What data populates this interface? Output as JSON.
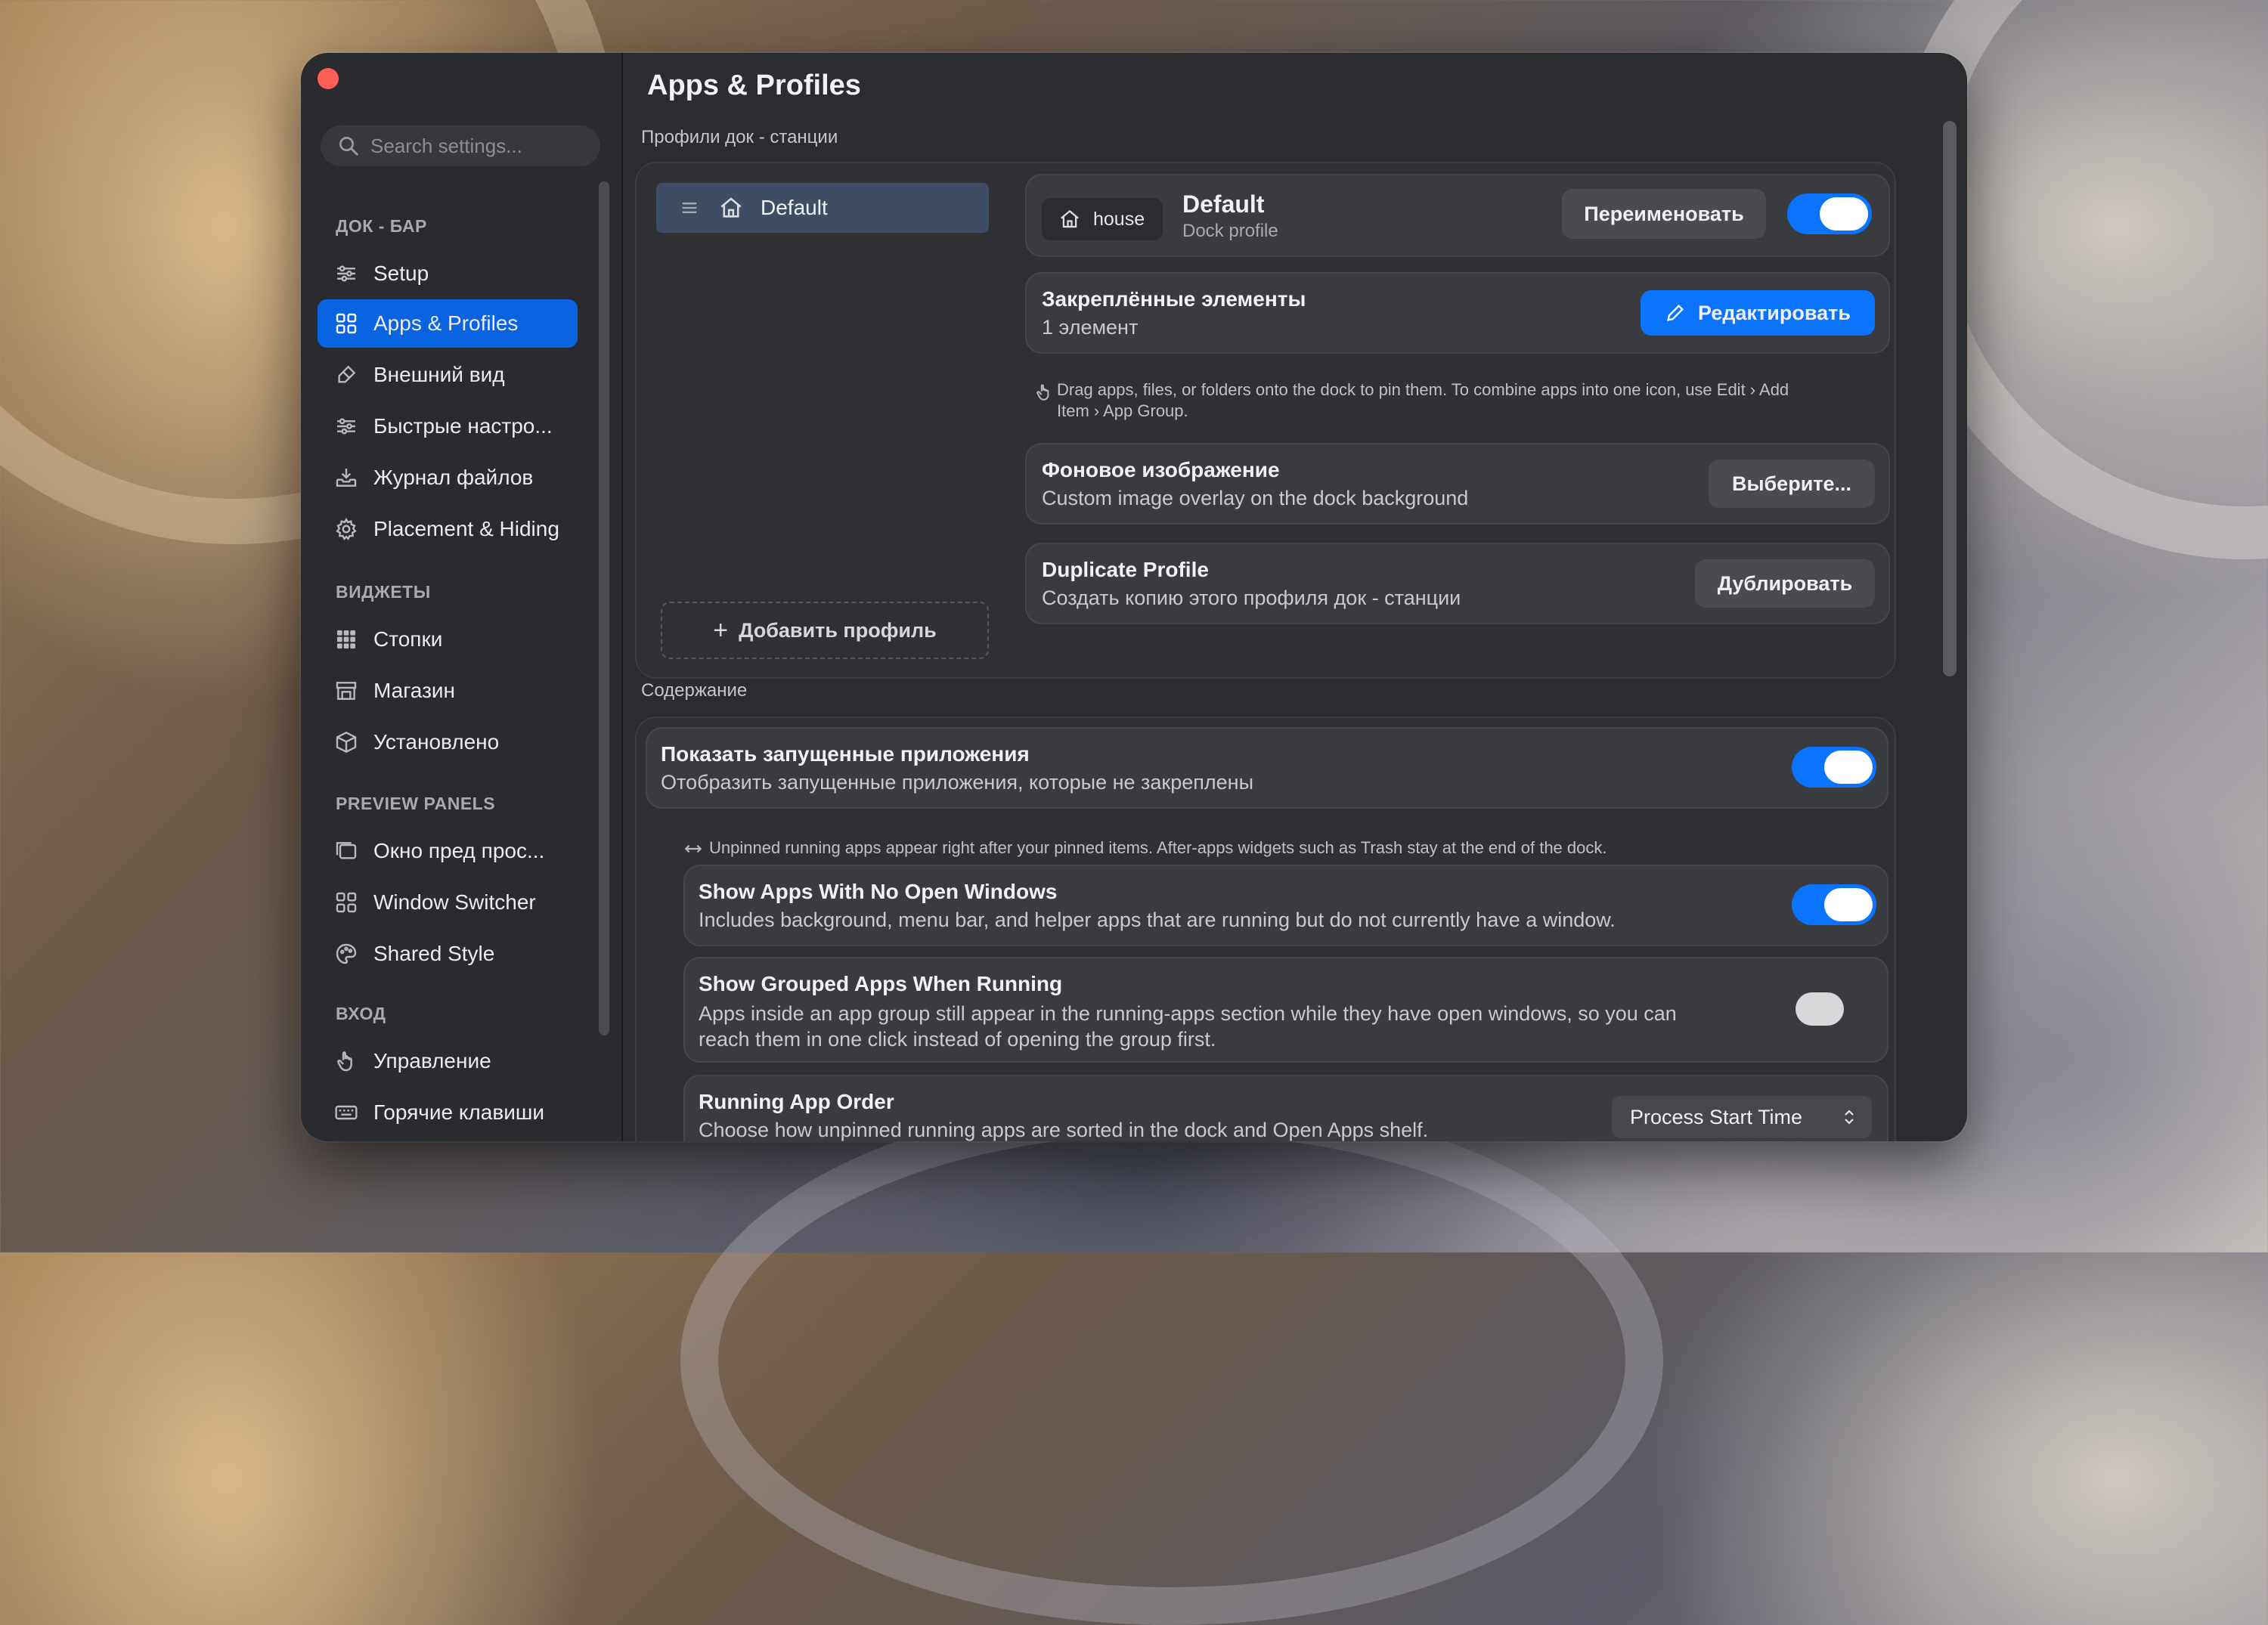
{
  "sidebar": {
    "search_placeholder": "Search settings...",
    "sections": [
      {
        "label": "ДОК - БАР",
        "items": [
          {
            "label": "Setup",
            "icon": "sliders-icon"
          },
          {
            "label": "Apps & Profiles",
            "icon": "grid-icon",
            "active": true
          },
          {
            "label": "Внешний вид",
            "icon": "brush-icon"
          },
          {
            "label": "Быстрые настро...",
            "icon": "sliders-icon"
          },
          {
            "label": "Журнал файлов",
            "icon": "tray-download-icon"
          },
          {
            "label": "Placement & Hiding",
            "icon": "gear-icon"
          }
        ]
      },
      {
        "label": "ВИДЖЕТЫ",
        "items": [
          {
            "label": "Стопки",
            "icon": "grid-filled-icon"
          },
          {
            "label": "Магазин",
            "icon": "store-icon"
          },
          {
            "label": "Установлено",
            "icon": "box-icon"
          }
        ]
      },
      {
        "label": "PREVIEW PANELS",
        "items": [
          {
            "label": "Окно пред прос...",
            "icon": "window-preview-icon"
          },
          {
            "label": "Window Switcher",
            "icon": "grid-icon"
          },
          {
            "label": "Shared Style",
            "icon": "palette-icon"
          }
        ]
      },
      {
        "label": "ВХОД",
        "items": [
          {
            "label": "Управление",
            "icon": "hand-icon"
          },
          {
            "label": "Горячие клавиши",
            "icon": "keyboard-icon"
          }
        ]
      }
    ]
  },
  "main": {
    "title": "Apps & Profiles",
    "profiles_group_label": "Профили док - станции",
    "profile_list": [
      {
        "label": "Default",
        "icon": "house-icon"
      }
    ],
    "add_profile_label": "Добавить профиль",
    "profile_header": {
      "icon_name": "house",
      "name": "Default",
      "subtitle": "Dock profile",
      "rename_label": "Переименовать",
      "enabled": true
    },
    "pinned": {
      "title": "Закреплённые элементы",
      "count_text": "1 элемент",
      "edit_label": "Редактировать"
    },
    "pinned_hint_line1": "Drag apps, files, or folders onto the dock to pin them. To combine apps into one icon, use Edit › Add",
    "pinned_hint_line2": "Item › App Group.",
    "background": {
      "title": "Фоновое изображение",
      "subtitle": "Custom image overlay on the dock background",
      "choose_label": "Выберите..."
    },
    "duplicate": {
      "title": "Duplicate Profile",
      "subtitle": "Создать копию этого профиля док - станции",
      "button_label": "Дублировать"
    },
    "content_group_label": "Содержание",
    "show_running": {
      "title": "Показать запущенные приложения",
      "subtitle": "Отобразить запущенные приложения, которые не закреплены",
      "enabled": true
    },
    "running_hint": "Unpinned running apps appear right after your pinned items. After-apps widgets such as Trash stay at the end of the dock.",
    "no_windows": {
      "title": "Show Apps With No Open Windows",
      "subtitle": "Includes background, menu bar, and helper apps that are running but do not currently have a window.",
      "enabled": true
    },
    "grouped": {
      "title": "Show Grouped Apps When Running",
      "subtitle_line1": "Apps inside an app group still appear in the running-apps section while they have open windows, so you can",
      "subtitle_line2": "reach them in one click instead of opening the group first.",
      "enabled": false
    },
    "order": {
      "title": "Running App Order",
      "subtitle": "Choose how unpinned running apps are sorted in the dock and Open Apps shelf.",
      "selected": "Process Start Time"
    }
  },
  "colors": {
    "accent": "#0a74ff",
    "sidebar_active": "#0a63e0",
    "close": "#ff5f57"
  }
}
